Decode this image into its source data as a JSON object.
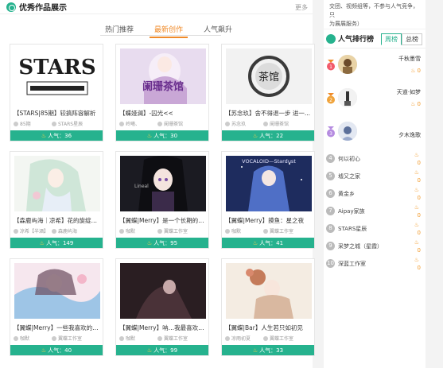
{
  "main": {
    "title": "优秀作品展示",
    "more": "更多",
    "tabs": [
      "热门推荐",
      "最新创作",
      "人气飙升"
    ]
  },
  "works": [
    {
      "title": "【STARS|85期】较搞阵容解析",
      "author": "85期",
      "team": "STARS星辰",
      "popularity": "人气：36"
    },
    {
      "title": "【蝶娅澜】-囚光<<",
      "author": "岭曦、",
      "team": "阑珊茶馆",
      "popularity": "人气：30"
    },
    {
      "title": "【苏念玖】舍不得退一步 进一...",
      "author": "苏念玖",
      "team": "阑珊茶馆",
      "popularity": "人气：22"
    },
    {
      "title": "【森鹿屿海｜凉希】花的旋绽，...",
      "author": "凉希【半酒】",
      "team": "森鹿屿海",
      "popularity": "人气：149"
    },
    {
      "title": "【翼蝶|Merry】是一个长期的堆...",
      "author": "咖默",
      "team": "翼蝶工作室",
      "popularity": "人气：95"
    },
    {
      "title": "【翼蝶|Merry】摸鱼：星之夜",
      "author": "咖默",
      "team": "翼蝶工作室",
      "popularity": "人气：41"
    },
    {
      "title": "【翼蝶|Merry】一些我喜欢的部...",
      "author": "咖默",
      "team": "翼蝶工作室",
      "popularity": "人气：40"
    },
    {
      "title": "【翼蝶|Merry】呐…我最喜欢你...",
      "author": "咖默",
      "team": "翼蝶工作室",
      "popularity": "人气：99"
    },
    {
      "title": "【翼蝶|Bar】人生若只如初见",
      "author": "凉雨初夏",
      "team": "翼蝶工作室",
      "popularity": "人气：33"
    }
  ],
  "side": {
    "note_line1": "交团、视频组等，不参与人气竞争，只",
    "note_line2": "为展展服务）"
  },
  "ranking": {
    "title": "人气排行榜",
    "tabs": [
      "周榜",
      "总榜"
    ],
    "top": [
      {
        "rank": "1",
        "name": "千秋墨雪",
        "score": "0"
      },
      {
        "rank": "2",
        "name": "天道·如梦",
        "score": "0"
      },
      {
        "rank": "3",
        "name": "夕木逸歌",
        "score": "0"
      }
    ],
    "list": [
      {
        "rank": "4",
        "name": "何以初心",
        "score": "0"
      },
      {
        "rank": "5",
        "name": "墟又之家",
        "score": "0"
      },
      {
        "rank": "6",
        "name": "黄金乡",
        "score": "0"
      },
      {
        "rank": "7",
        "name": "Aipay家族",
        "score": "0"
      },
      {
        "rank": "8",
        "name": "STARS星辰",
        "score": "0"
      },
      {
        "rank": "9",
        "name": "采梦之城（星霞）",
        "score": "0"
      },
      {
        "rank": "10",
        "name": "深蓝工作室",
        "score": "0"
      }
    ]
  },
  "colors": {
    "accent": "#26b28e",
    "orange": "#f08b2a"
  }
}
